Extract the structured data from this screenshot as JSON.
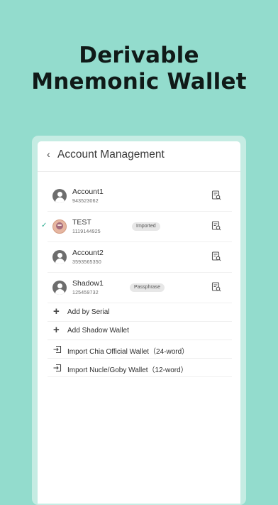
{
  "headline": {
    "line1": "Derivable",
    "line2": "Mnemonic Wallet"
  },
  "topbar": {
    "back_icon": "chevron-left",
    "title": "Account Management"
  },
  "accounts": [
    {
      "name": "Account1",
      "fingerprint": "943523062",
      "tag": "",
      "selected": false,
      "avatar": "user-icon",
      "detail_icon": "search-document-icon"
    },
    {
      "name": "TEST",
      "fingerprint": "1119144925",
      "tag": "Imported",
      "selected": true,
      "avatar": "custom-avatar",
      "detail_icon": "search-document-icon"
    },
    {
      "name": "Account2",
      "fingerprint": "3593565350",
      "tag": "",
      "selected": false,
      "avatar": "user-icon",
      "detail_icon": "search-document-icon"
    },
    {
      "name": "Shadow1",
      "fingerprint": "125459732",
      "tag": "Passphrase",
      "selected": false,
      "avatar": "user-icon",
      "detail_icon": "search-document-icon"
    }
  ],
  "actions": [
    {
      "label": "Add by Serial",
      "icon": "plus-icon"
    },
    {
      "label": "Add Shadow Wallet",
      "icon": "plus-icon"
    },
    {
      "label": "Import Chia Official Wallet（24-word）",
      "icon": "import-icon"
    },
    {
      "label": "Import Nucle/Goby Wallet（12-word）",
      "icon": "import-icon"
    }
  ],
  "colors": {
    "background": "#93dccd",
    "frame": "#c5ece3",
    "check": "#2fae92"
  }
}
